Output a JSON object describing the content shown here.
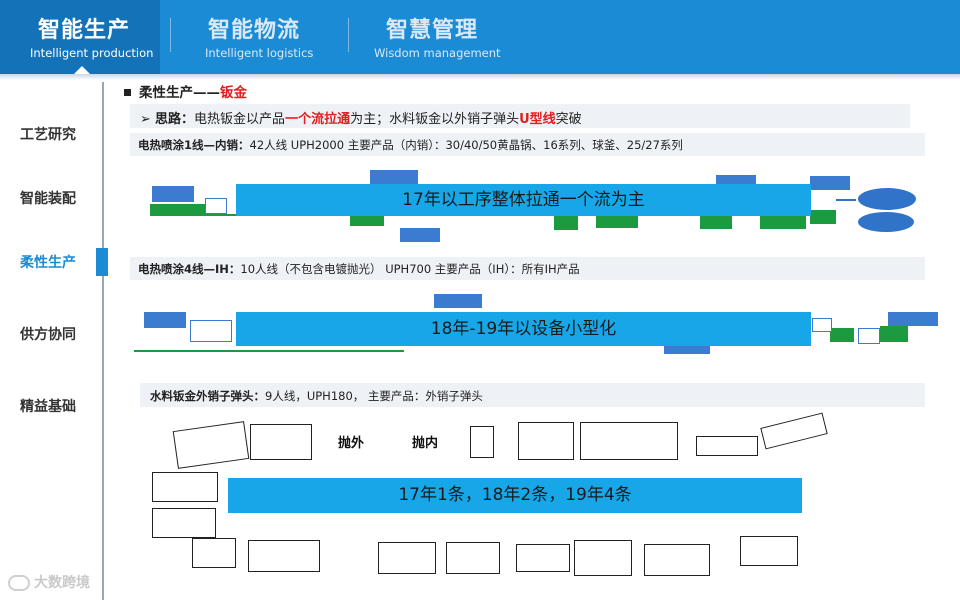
{
  "header": {
    "tabs": [
      {
        "cn": "智能生产",
        "en": "Intelligent production"
      },
      {
        "cn": "智能物流",
        "en": "Intelligent logistics"
      },
      {
        "cn": "智慧管理",
        "en": "Wisdom management"
      }
    ]
  },
  "sidebar": {
    "items": [
      "工艺研究",
      "智能装配",
      "柔性生产",
      "供方协同",
      "精益基础"
    ],
    "active": "柔性生产"
  },
  "section": {
    "title_prefix": "柔性生产——",
    "title_highlight": "钣金"
  },
  "idea": {
    "label": "思路：",
    "text1": "电热钣金以产品",
    "highlight1": "一个流拉通",
    "text2": "为主；水料钣金以外销子弹头",
    "highlight2": "U型线",
    "text3": "突破"
  },
  "lines": [
    {
      "name": "电热喷涂1线—内销：",
      "desc": "42人线  UPH2000   主要产品（内销）：30/40/50黄晶锅、16系列、球釜、25/27系列",
      "banner": "17年以工序整体拉通一个流为主"
    },
    {
      "name": "电热喷涂4线—IH：",
      "desc": "10人线（不包含电镀抛光）  UPH700  主要产品（IH）：所有IH产品",
      "banner": "18年-19年以设备小型化"
    },
    {
      "name": "水料钣金外销子弹头：",
      "desc": "9人线，UPH180，  主要产品：外销子弹头",
      "banner": "17年1条，18年2条，19年4条"
    }
  ],
  "sketch_labels": [
    "抛外",
    "抛内"
  ],
  "watermark": "大数跨境"
}
